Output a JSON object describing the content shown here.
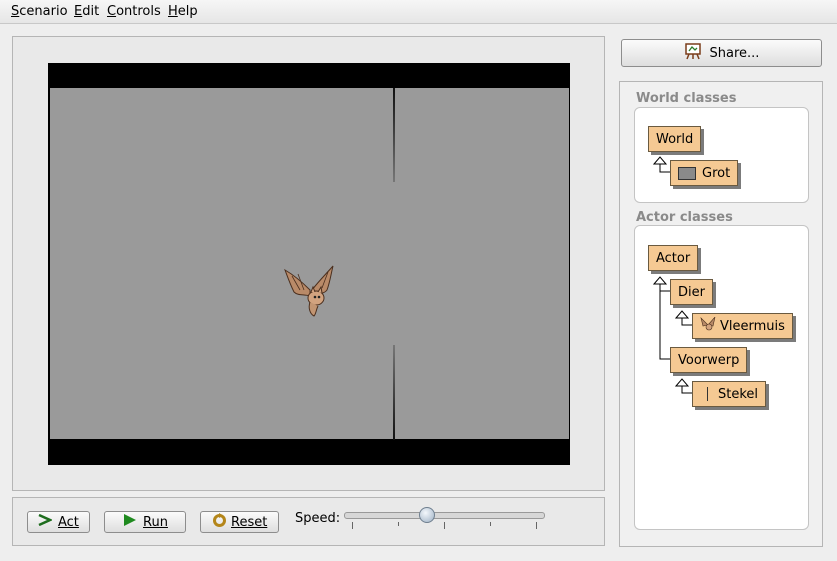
{
  "menu": {
    "items": [
      {
        "first": "S",
        "rest": "cenario"
      },
      {
        "first": "E",
        "rest": "dit"
      },
      {
        "first": "C",
        "rest": "ontrols"
      },
      {
        "first": "H",
        "rest": "elp"
      }
    ]
  },
  "controls": {
    "act_label": "Act",
    "run_label": "Run",
    "reset_label": "Reset",
    "speed_label": "Speed:",
    "speed_fraction": 0.41
  },
  "share": {
    "label": "Share..."
  },
  "world_classes": {
    "title": "World classes",
    "root": "World",
    "child": "Grot"
  },
  "actor_classes": {
    "title": "Actor classes",
    "root": "Actor",
    "dier": "Dier",
    "vleermuis": "Vleermuis",
    "voorwerp": "Voorwerp",
    "stekel": "Stekel"
  },
  "colors": {
    "class_box": "#f5c993",
    "world_bg": "#9a9a9a"
  }
}
